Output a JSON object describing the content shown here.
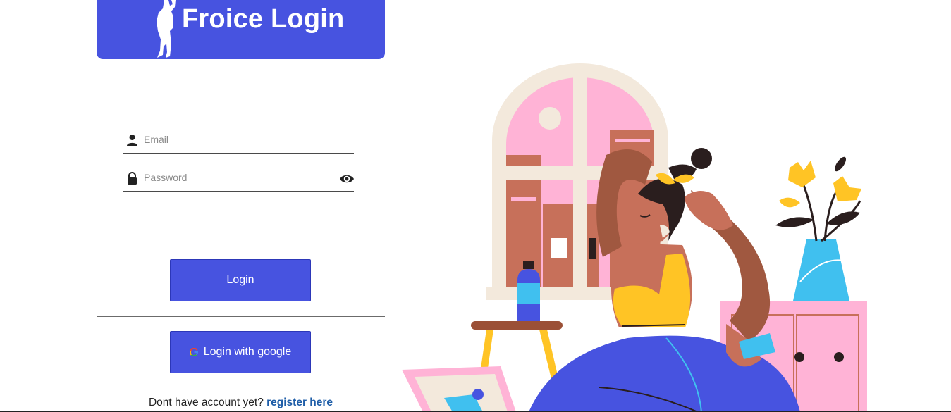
{
  "header": {
    "title": "Froice Login"
  },
  "form": {
    "email": {
      "placeholder": "Email",
      "value": ""
    },
    "password": {
      "placeholder": "Password",
      "value": ""
    }
  },
  "buttons": {
    "login": "Login",
    "google": "Login with google"
  },
  "register": {
    "prompt": "Dont have account yet?",
    "link": "register here"
  },
  "colors": {
    "primary": "#4753e0",
    "link": "#1f5ea8",
    "illustration_pink": "#ffb3d6",
    "illustration_yellow": "#ffc425"
  }
}
